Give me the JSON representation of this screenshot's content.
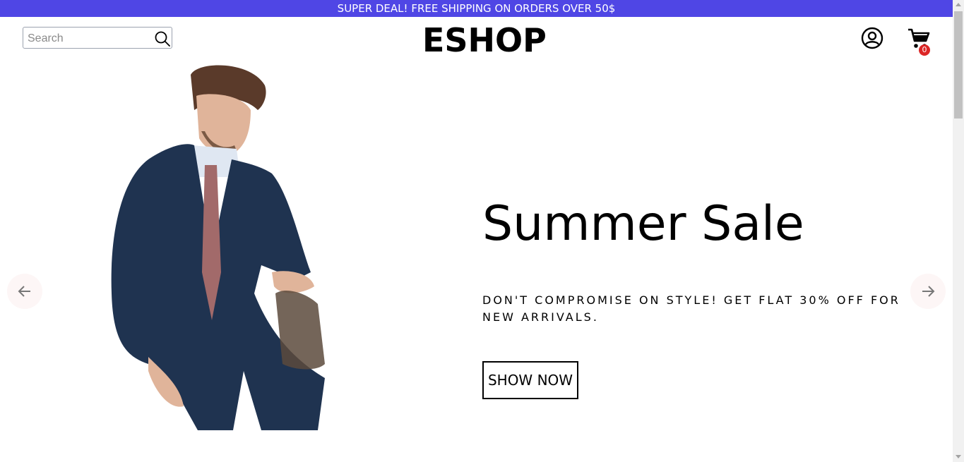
{
  "announcement": "SUPER DEAL! FREE SHIPPING ON ORDERS OVER 50$",
  "header": {
    "search": {
      "placeholder": "Search",
      "value": ""
    },
    "logo": "ESHOP",
    "cart_count": "0"
  },
  "slide": {
    "title": "Summer Sale",
    "description": "DON'T COMPROMISE ON STYLE! GET FLAT 30% OFF FOR NEW ARRIVALS.",
    "button_label": "SHOW NOW"
  },
  "colors": {
    "announcement_bg": "#4f46e5",
    "badge": "#dc2626",
    "arrow_bg": "#fdf6f6"
  },
  "icons": [
    "search-icon",
    "account-icon",
    "cart-icon",
    "arrow-left-icon",
    "arrow-right-icon"
  ]
}
